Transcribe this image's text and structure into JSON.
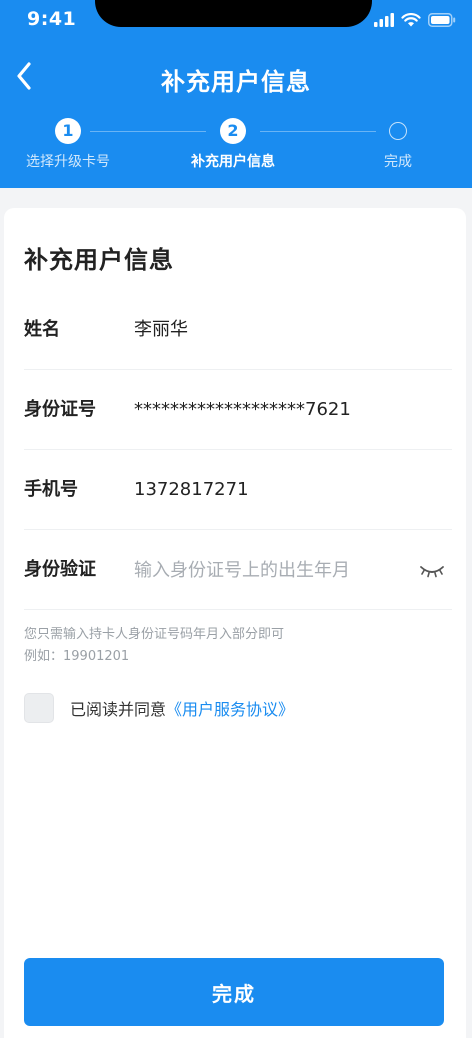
{
  "status_bar": {
    "time": "9:41"
  },
  "nav": {
    "title": "补充用户信息",
    "back_icon": "chevron-left-icon"
  },
  "stepper": {
    "steps": [
      {
        "number": "1",
        "label": "选择升级卡号",
        "state": "done"
      },
      {
        "number": "2",
        "label": "补充用户信息",
        "state": "active"
      },
      {
        "number": "",
        "label": "完成",
        "state": "pending"
      }
    ]
  },
  "form": {
    "title": "补充用户信息",
    "name": {
      "label": "姓名",
      "value": "李丽华"
    },
    "id_number": {
      "label": "身份证号",
      "value": "*******************7621"
    },
    "phone": {
      "label": "手机号",
      "value": "13728172​71"
    },
    "id_verify": {
      "label": "身份验证",
      "value": "",
      "placeholder": "输入身份证号上的出生年月"
    },
    "hint_line1": "您只需输入持卡人身份证号码年月入部分即可",
    "hint_line2": "例如：19901201",
    "agree_text": "已阅读并同意",
    "agree_link": "《用户服务协议》",
    "agree_checked": false
  },
  "submit": {
    "label": "完成"
  },
  "colors": {
    "primary": "#1a8cf0",
    "background": "#f3f4f6"
  }
}
